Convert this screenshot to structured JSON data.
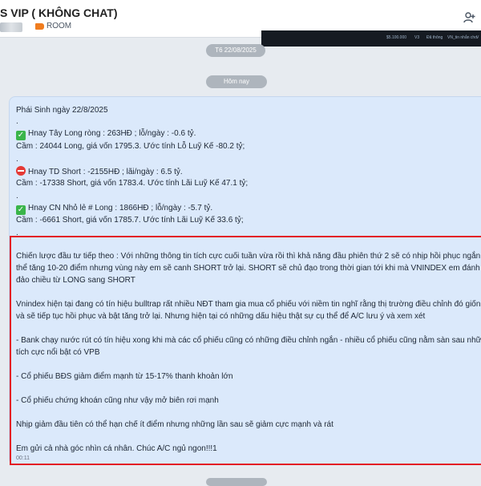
{
  "header": {
    "chat_title": "S VIP ( KHÔNG CHAT)",
    "tag_label": "ROOM",
    "members_icon": "add-members-icon"
  },
  "preview_strip": {
    "items": [
      "$5.100.000",
      "V3",
      "Đã thông",
      "VN_tin nhắn cho",
      "V"
    ]
  },
  "separators": {
    "date": "T6 22/08/2025",
    "today": "Hôm nay"
  },
  "message": {
    "lines": [
      "Phái Sinh ngày 22/8/2025",
      ".",
      "Hnay Tây Long ròng : 263HĐ ; lỗ/ngày : -0.6 tỷ.",
      "Cầm : 24044 Long, giá vốn 1795.3. Ước tính Lỗ Luỹ Kế -80.2 tỷ;",
      ".",
      "Hnay TD Short : -2155HĐ ; lãi/ngày : 6.5 tỷ.",
      "Cầm : -17338 Short, giá vốn 1783.4. Ước tính Lãi Luỹ Kế 47.1 tỷ;",
      ".",
      "Hnay CN Nhỏ lẻ # Long : 1866HĐ ; lỗ/ngày : -5.7 tỷ.",
      "Cầm : -6661 Short, giá vốn 1785.7. Ước tính Lãi Luỹ Kế 33.6 tỷ;",
      ".",
      "Chiến lược đầu tư tiếp theo : Với những thông tin tích cực cuối tuần vừa rồi thì khả năng đầu phiên thứ 2 sẽ có nhịp hồi phục ngắn t",
      "thể tăng 10-20 điểm nhưng vùng này em sẽ canh SHORT trở lại. SHORT sẽ chủ đạo trong thời gian tới khi mà VNINDEX em đánh giá",
      "đảo chiều từ LONG sang SHORT",
      "Vnindex hiện tại đang có tín hiệu bulltrap rất nhiều NĐT tham gia mua cổ phiếu với niềm tin nghĩ rằng thị trường điều chỉnh đó giốn",
      "và sẽ tiếp tục hồi phục và bật tăng trở lại. Nhưng hiện tại có những dấu hiệu thật sự cụ thể để A/C lưu ý và xem xét",
      "- Bank chạy nước rút có tín hiệu xong khi mà các cổ phiếu cũng có những điều chỉnh ngắn - nhiều cổ phiếu cũng nằm sàn sau nhữn",
      "tích cực nổi bật có VPB",
      "- Cổ phiếu BĐS giảm điểm mạnh từ 15-17% thanh khoản lớn",
      "- Cổ phiếu chứng khoán cũng như vậy mở biên rơi mạnh",
      "Nhịp giảm đầu tiên có thể hạn chế ít điểm nhưng những lần sau sẽ giảm cực mạnh và rát",
      "Em gửi cả nhà góc nhìn cá nhân. Chúc A/C ngủ ngon!!!1"
    ],
    "time": "00:11",
    "icons": [
      "check-mark-icon",
      "no-entry-icon",
      "check-mark-icon"
    ],
    "colors": {
      "bubble": "#dbe9fb",
      "highlight": "#e31e24",
      "check": "#3ab54a",
      "no_entry": "#e53935"
    }
  }
}
